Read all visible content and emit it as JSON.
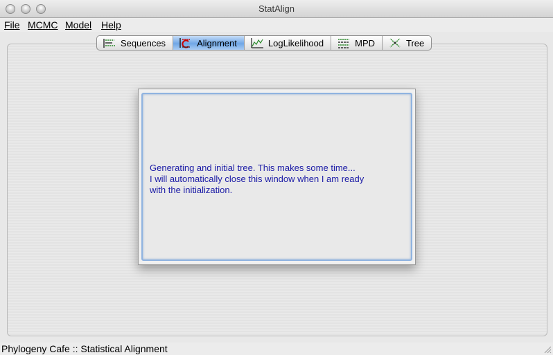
{
  "window": {
    "title": "StatAlign"
  },
  "menu": {
    "items": [
      "File",
      "MCMC",
      "Model",
      "Help"
    ]
  },
  "tabs": [
    {
      "label": "Sequences",
      "icon": "sequences-icon"
    },
    {
      "label": "Alignment",
      "icon": "alignment-icon",
      "selected": true
    },
    {
      "label": "LogLikelihood",
      "icon": "loglikelihood-chart-icon"
    },
    {
      "label": "MPD",
      "icon": "mpd-icon"
    },
    {
      "label": "Tree",
      "icon": "tree-icon"
    }
  ],
  "dialog": {
    "lines": [
      "Generating and initial tree. This makes some time...",
      "I will automatically close this window when I am ready",
      "with the initialization."
    ]
  },
  "status": {
    "text": "Phylogeny Cafe :: Statistical Alignment"
  },
  "colors": {
    "dialog_text": "#1a1aa6",
    "active_tab": "#6fa7e6"
  }
}
